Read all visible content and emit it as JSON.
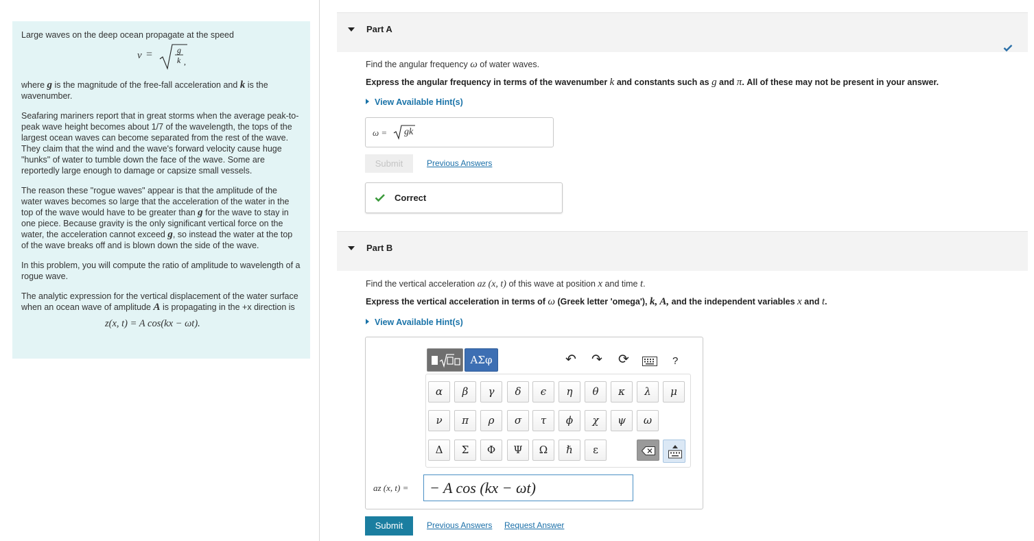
{
  "problem": {
    "intro": "Large waves on the deep ocean propagate at the speed",
    "speed_lhs": "v",
    "where_1": "where ",
    "where_g": "g",
    "where_2": " is the magnitude of the free-fall acceleration and ",
    "where_k": "k",
    "where_3": " is the wavenumber.",
    "para_mariners": "Seafaring mariners report that in great storms when the average peak-to-peak wave height becomes about 1/7 of the wavelength, the tops of the largest ocean waves can become separated from the rest of the wave. They claim that the wind and the wave's forward velocity cause huge \"hunks\" of water to tumble down the face of the wave. Some are reportedly large enough to damage or capsize small vessels.",
    "rogue_1": "The reason these \"rogue waves\" appear is that the amplitude of the water waves becomes so large that the acceleration of the water in the top of the wave would have to be greater than ",
    "rogue_g1": "g",
    "rogue_2": " for the wave to stay in one piece. Because gravity is the only significant vertical force on the water, the acceleration cannot exceed ",
    "rogue_g2": "g",
    "rogue_3": ", so instead the water at the top of the wave breaks off and is blown down the side of the wave.",
    "para_compute": "In this problem, you will compute the ratio of amplitude to wavelength of a rogue wave.",
    "analytic_1": "The analytic expression for the vertical displacement of the water surface when an ocean wave of amplitude ",
    "analytic_A": "A",
    "analytic_2": " is propagating in the +x direction is",
    "displacement_eq": "z(x, t) = A cos(kx − ωt)."
  },
  "partA": {
    "title": "Part A",
    "question_1": "Find the angular frequency ",
    "question_w": "ω",
    "question_2": " of water waves.",
    "instruction_1": "Express the angular frequency in terms of the wavenumber ",
    "instruction_k": "k",
    "instruction_2": " and constants such as ",
    "instruction_g": "g",
    "instruction_3": " and ",
    "instruction_pi": "π",
    "instruction_4": ". All of these may not be present in your answer.",
    "hint_label": "View Available Hint(s)",
    "answer_label": "ω =",
    "answer_value": "gk",
    "submit_label": "Submit",
    "previous_answers_label": "Previous Answers",
    "feedback_label": "Correct"
  },
  "partB": {
    "title": "Part B",
    "question_1": "Find the vertical acceleration ",
    "question_az": "az (x, t)",
    "question_2": " of this wave at position ",
    "question_x": "x",
    "question_3": " and time ",
    "question_t": "t",
    "question_4": ".",
    "instruction_1": "Express the vertical acceleration in terms of ",
    "instruction_w": "ω",
    "instruction_2": " (Greek letter 'omega'),  ",
    "instruction_vars": "k, A,",
    "instruction_3": " and the independent variables ",
    "instruction_x": "x",
    "instruction_4": " and ",
    "instruction_t": "t",
    "instruction_5": ".",
    "hint_label": "View Available Hint(s)",
    "template_button": "ΑΣφ",
    "greek_row1": [
      "α",
      "β",
      "γ",
      "δ",
      "ϵ",
      "η",
      "θ",
      "κ",
      "λ",
      "μ"
    ],
    "greek_row2": [
      "ν",
      "π",
      "ρ",
      "σ",
      "τ",
      "ϕ",
      "χ",
      "ψ",
      "ω"
    ],
    "greek_row3": [
      "Δ",
      "Σ",
      "Φ",
      "Ψ",
      "Ω",
      "ℏ",
      "ε"
    ],
    "help_label": "?",
    "answer_label": "az (x, t) =",
    "answer_value": "− A cos (kx − ωt)",
    "submit_label": "Submit",
    "previous_answers_label": "Previous Answers",
    "request_answer_label": "Request Answer"
  },
  "colors": {
    "problem_bg": "#e3f4f5",
    "link": "#1a6fa8",
    "submit": "#1b7ea0",
    "correct": "#3c9a3c",
    "check": "#2a6fa8"
  }
}
